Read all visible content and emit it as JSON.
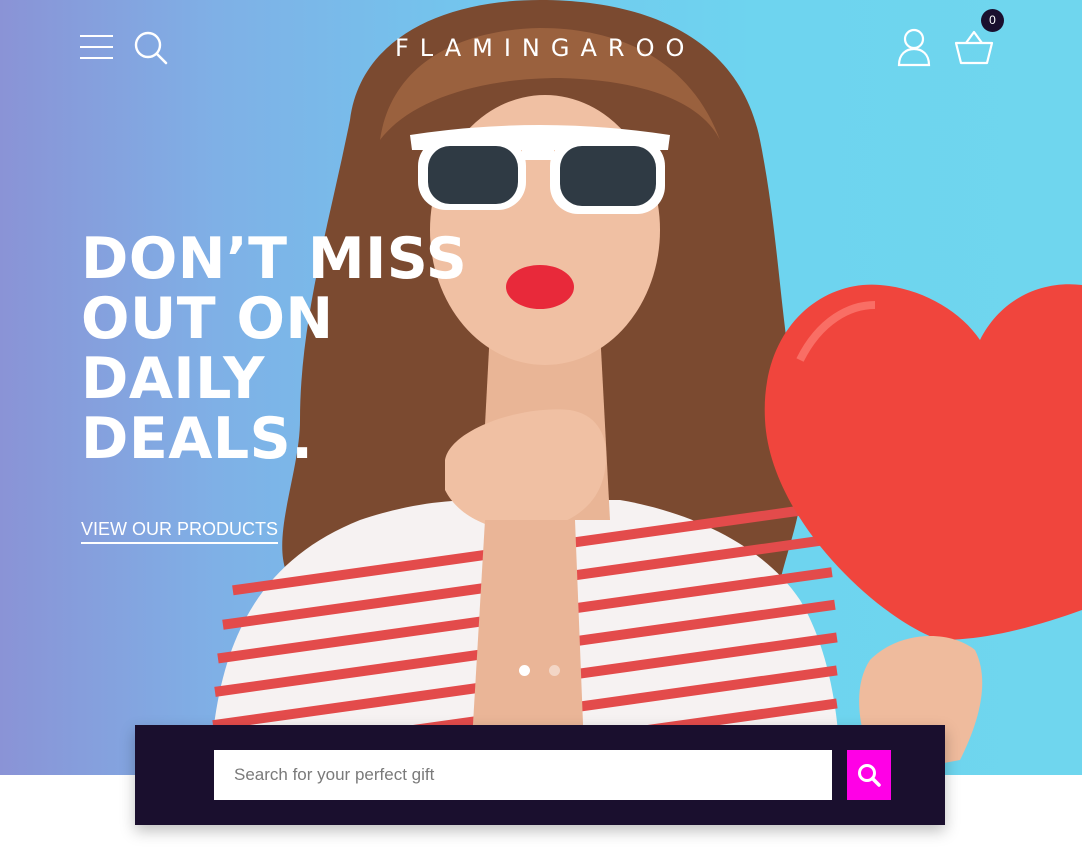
{
  "header": {
    "logo": "FLAMINGAROO",
    "cart_count": "0"
  },
  "hero": {
    "headline_lines": [
      "DON’T MISS",
      "OUT ON",
      "DAILY",
      "DEALS."
    ],
    "cta_label": "VIEW OUR PRODUCTS",
    "slide_count": 2,
    "active_slide": 1
  },
  "search": {
    "placeholder": "Search for your perfect gift"
  },
  "icons": {
    "menu": "hamburger-menu-icon",
    "search": "search-icon",
    "account": "user-icon",
    "cart": "basket-icon",
    "submit": "search-icon"
  },
  "colors": {
    "search_bar_bg": "#1a0f2e",
    "search_button": "#ff00e6",
    "cart_badge": "#1a0f2e",
    "text_light": "#ffffff"
  }
}
